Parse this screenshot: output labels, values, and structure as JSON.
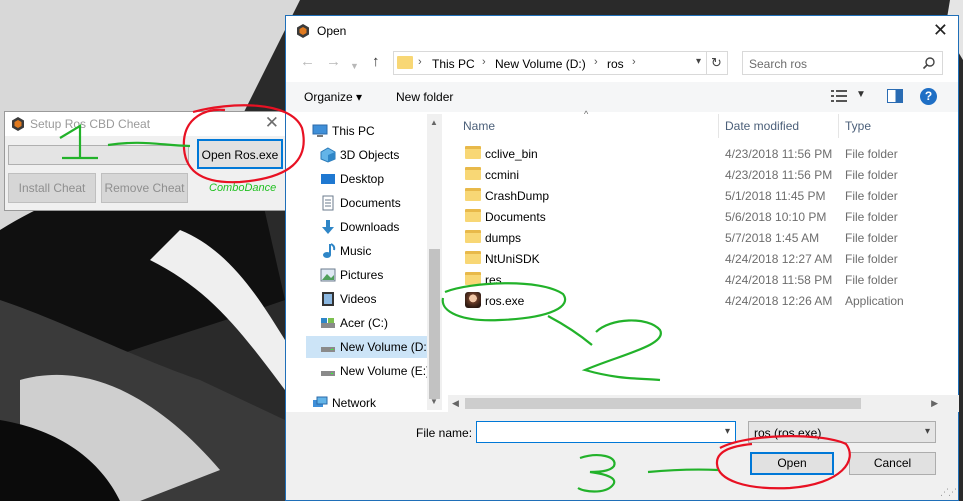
{
  "setup_window": {
    "title": "Setup Ros CBD Cheat",
    "open_button": "Open Ros.exe",
    "install_button": "Install Cheat",
    "remove_button": "Remove Cheat",
    "note": "ComboDance"
  },
  "dialog": {
    "title": "Open",
    "address": {
      "items": [
        "This PC",
        "New Volume (D:)",
        "ros"
      ]
    },
    "search_placeholder": "Search ros",
    "toolbar": {
      "organize": "Organize ▾",
      "new_folder": "New folder",
      "help": "?"
    },
    "nav": [
      {
        "label": "This PC",
        "icon": "pc-icon"
      },
      {
        "label": "3D Objects",
        "icon": "cube-icon"
      },
      {
        "label": "Desktop",
        "icon": "desktop-icon"
      },
      {
        "label": "Documents",
        "icon": "documents-icon"
      },
      {
        "label": "Downloads",
        "icon": "download-icon"
      },
      {
        "label": "Music",
        "icon": "music-icon"
      },
      {
        "label": "Pictures",
        "icon": "pictures-icon"
      },
      {
        "label": "Videos",
        "icon": "videos-icon"
      },
      {
        "label": "Acer (C:)",
        "icon": "drive-icon"
      },
      {
        "label": "New Volume (D:",
        "icon": "drive-icon"
      },
      {
        "label": "New Volume (E:)",
        "icon": "drive-icon"
      },
      {
        "label": "Network",
        "icon": "network-icon"
      }
    ],
    "columns": {
      "name": "Name",
      "date": "Date modified",
      "type": "Type"
    },
    "files": [
      {
        "name": "cclive_bin",
        "date": "4/23/2018 11:56 PM",
        "type": "File folder"
      },
      {
        "name": "ccmini",
        "date": "4/23/2018 11:56 PM",
        "type": "File folder"
      },
      {
        "name": "CrashDump",
        "date": "5/1/2018 11:45 PM",
        "type": "File folder"
      },
      {
        "name": "Documents",
        "date": "5/6/2018 10:10 PM",
        "type": "File folder"
      },
      {
        "name": "dumps",
        "date": "5/7/2018 1:45 AM",
        "type": "File folder"
      },
      {
        "name": "NtUniSDK",
        "date": "4/24/2018 12:27 AM",
        "type": "File folder"
      },
      {
        "name": "res",
        "date": "4/24/2018 11:58 PM",
        "type": "File folder"
      },
      {
        "name": "ros.exe",
        "date": "4/24/2018 12:26 AM",
        "type": "Application"
      }
    ],
    "file_name_label": "File name:",
    "file_name_value": "",
    "filter": "ros (ros.exe)",
    "open_button": "Open",
    "cancel_button": "Cancel"
  },
  "annotations": [
    "1",
    "2",
    "3"
  ],
  "colors": {
    "accent": "#0078d7",
    "annotation_red": "#e81123",
    "annotation_green": "#22b22a",
    "selected_nav": "#cce4f7"
  }
}
